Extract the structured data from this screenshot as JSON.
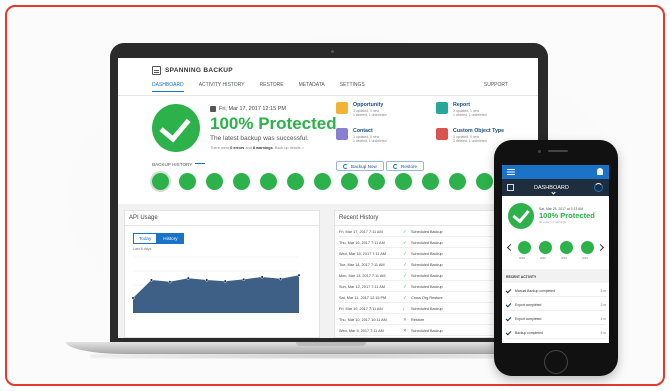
{
  "colors": {
    "frame": "#e23b2e",
    "accent": "#1a73c7",
    "success": "#2db24b",
    "dark_bar": "#1e2e3e"
  },
  "laptop": {
    "brand": "SPANNING BACKUP",
    "nav": [
      "DASHBOARD",
      "ACTIVITY HISTORY",
      "RESTORE",
      "METADATA",
      "SETTINGS"
    ],
    "nav_active": "DASHBOARD",
    "support": "SUPPORT",
    "hero": {
      "date": "Fri, Mar 17, 2017 12:15 PM",
      "headline": "100% Protected",
      "message": "The latest backup was successful.",
      "warnings_prefix": "There were ",
      "warnings_errors": "0 errors",
      "warnings_mid": " and ",
      "warnings_count": "8 warnings",
      "warnings_suffix": ". Back up details >"
    },
    "cards": [
      {
        "title": "Opportunity",
        "line1": "3 updated, 0 new",
        "line2": "1 deleted, 1 undeleted",
        "icon": "crown-icon",
        "color": "#f2b233"
      },
      {
        "title": "Report",
        "line1": "3 updated, 1 new",
        "line2": "1 deleted, 1 undeleted",
        "icon": "report-icon",
        "color": "#27a79a"
      },
      {
        "title": "Contact",
        "line1": "3 updated, 0 new",
        "line2": "1 deleted, 1 undeleted",
        "icon": "contact-card-icon",
        "color": "#8a7fd0"
      },
      {
        "title": "Custom Object Type",
        "line1": "3 updated, 0 new",
        "line2": "3 deleted, 1 undeleted",
        "icon": "lock-icon",
        "color": "#d9534f"
      }
    ],
    "buttons": {
      "backup_now": "Backup Now",
      "restore": "Restore"
    },
    "backup_history_label": "BACKUP HISTORY",
    "backup_history_count": 14,
    "api_usage": {
      "title": "API Usage",
      "toggle": [
        "Today",
        "History"
      ],
      "toggle_active": "History",
      "period": "Last 8 days",
      "points": [
        0.25,
        0.55,
        0.52,
        0.58,
        0.55,
        0.53,
        0.56,
        0.6,
        0.57,
        0.63
      ]
    },
    "recent_history": {
      "title": "Recent History",
      "rows": [
        {
          "date": "Fri, Mar 17, 2017 7:11 AM",
          "status": "ok",
          "label": "Scheduled Backup"
        },
        {
          "date": "Thu, Mar 16, 2017 7:11 AM",
          "status": "ok",
          "label": "Scheduled Backup"
        },
        {
          "date": "Wed, Mar 15, 2017 7:11 AM",
          "status": "ok",
          "label": "Scheduled Backup"
        },
        {
          "date": "Tue, Mar 14, 2017 7:11 AM",
          "status": "ok",
          "label": "Scheduled Backup"
        },
        {
          "date": "Mon, Mar 13, 2017 7:11 AM",
          "status": "ok",
          "label": "Scheduled Backup"
        },
        {
          "date": "Sun, Mar 12, 2017 7:11 AM",
          "status": "ok",
          "label": "Scheduled Backup"
        },
        {
          "date": "Sat, Mar 11, 2017 12:15 PM",
          "status": "ok",
          "label": "Cross Org Restore"
        },
        {
          "date": "Fri, Mar 10, 2017 7:11 AM",
          "status": "warn",
          "label": "Scheduled Backup"
        },
        {
          "date": "Thu, Mar 10, 2017 10:11 AM",
          "status": "bad",
          "label": "Restore"
        },
        {
          "date": "Wed, Mar 9, 2017 7:11 AM",
          "status": "bad",
          "label": "Scheduled Backup"
        }
      ]
    }
  },
  "phone": {
    "header": "DASHBOARD",
    "date": "Sat, Mar 25, 2017 at 3:13 AM",
    "headline": "100% Protected",
    "warnings": "No errors or warnings",
    "dots": [
      "3/20",
      "3/22",
      "3/24",
      "3/23"
    ],
    "recent_label": "RECENT ACTIVITY",
    "activity": [
      {
        "label": "Manual Backup completed",
        "time": "3 m"
      },
      {
        "label": "Export completed",
        "time": "3 m"
      },
      {
        "label": "Export completed",
        "time": "4 m"
      },
      {
        "label": "Backup completed",
        "time": "5 m"
      }
    ]
  }
}
